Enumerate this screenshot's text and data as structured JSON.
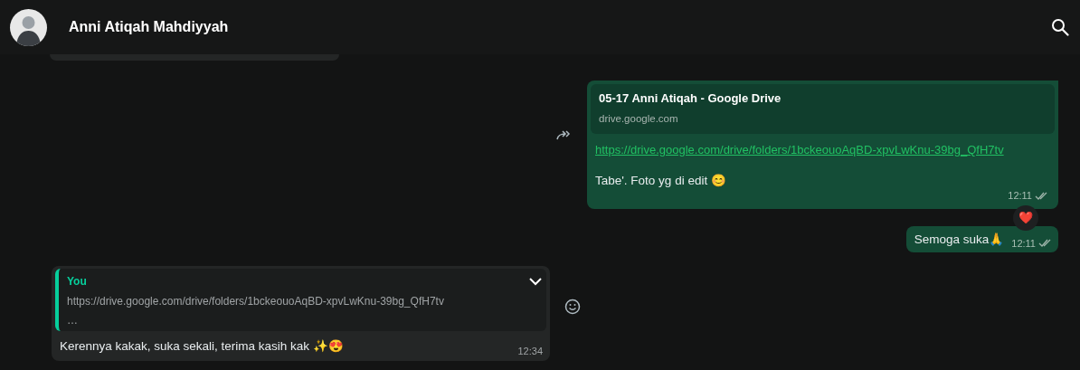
{
  "header": {
    "contact_name": "Anni Atiqah Mahdiyyah"
  },
  "messages": [
    {
      "kind": "link",
      "preview_title": "05-17 Anni Atiqah - Google Drive",
      "preview_domain": "drive.google.com",
      "link": "https://drive.google.com/drive/folders/1bckeouoAqBD-xpvLwKnu-39bg_QfH7tv",
      "text": "Tabe'. Foto yg di edit 😊",
      "time": "12:11",
      "read": false,
      "forwardable": true,
      "reaction": "❤️"
    },
    {
      "kind": "text",
      "text": "Semoga suka🙏",
      "time": "12:11",
      "read": false
    },
    {
      "kind": "reply",
      "quote_author": "You",
      "quote_text": "https://drive.google.com/drive/folders/1bckeouoAqBD-xpvLwKnu-39bg_QfH7tv",
      "quote_more": "…",
      "text": "Kerennya kakak, suka sekali, terima kasih kak ✨😍",
      "time": "12:34",
      "menu_open": false
    }
  ]
}
